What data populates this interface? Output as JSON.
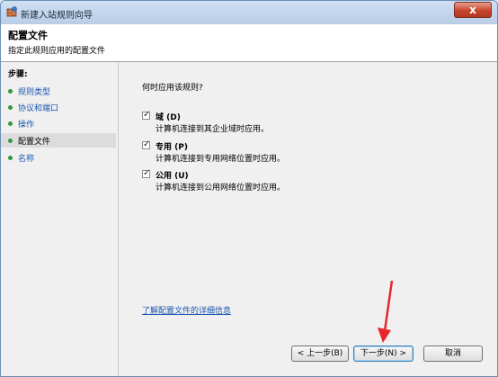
{
  "window": {
    "title": "新建入站规则向导",
    "close_label": "x"
  },
  "header": {
    "title": "配置文件",
    "subtitle": "指定此规则应用的配置文件"
  },
  "steps": {
    "label": "步骤:",
    "items": [
      {
        "label": "规则类型",
        "current": false
      },
      {
        "label": "协议和端口",
        "current": false
      },
      {
        "label": "操作",
        "current": false
      },
      {
        "label": "配置文件",
        "current": true
      },
      {
        "label": "名称",
        "current": false
      }
    ]
  },
  "content": {
    "question": "何时应用该规则?",
    "options": [
      {
        "title": "域 (D)",
        "description": "计算机连接到其企业域时应用。",
        "checked": true
      },
      {
        "title": "专用 (P)",
        "description": "计算机连接到专用网络位置时应用。",
        "checked": true
      },
      {
        "title": "公用 (U)",
        "description": "计算机连接到公用网络位置时应用。",
        "checked": true
      }
    ],
    "learn_more": "了解配置文件的详细信息"
  },
  "buttons": {
    "back": "< 上一步(B)",
    "next": "下一步(N) >",
    "cancel": "取消"
  },
  "colors": {
    "link": "#1a56b0",
    "step_dot": "#2f9a3a",
    "annotation_arrow": "#e8262a"
  }
}
